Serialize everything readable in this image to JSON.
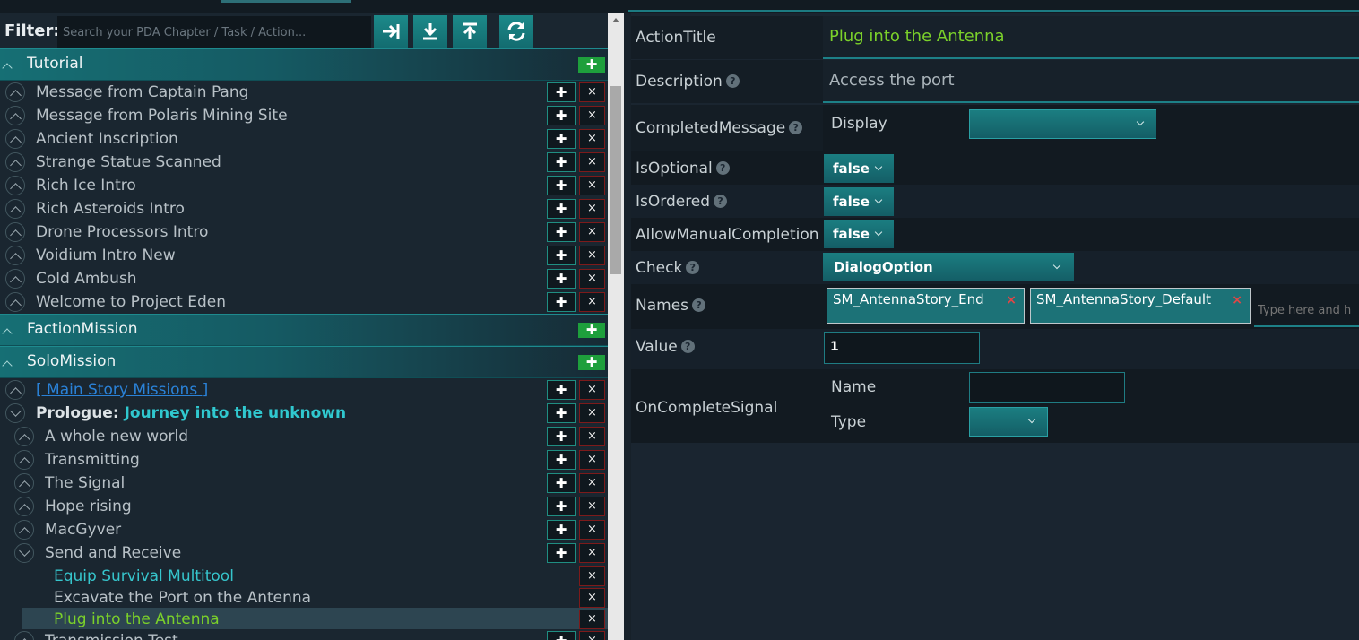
{
  "filter": {
    "label": "Filter:",
    "placeholder": "Search your PDA Chapter / Task / Action...",
    "buttons": [
      "arrow-right-bar-icon",
      "download-icon",
      "upload-icon",
      "refresh-icon"
    ]
  },
  "categories": {
    "tutorial": "Tutorial",
    "faction": "FactionMission",
    "solo": "SoloMission"
  },
  "tutorial_items": [
    "Message from Captain Pang",
    "Message from Polaris Mining Site",
    "Ancient Inscription",
    "Strange Statue Scanned",
    "Rich Ice Intro",
    "Rich Asteroids Intro",
    "Drone Processors Intro",
    "Voidium Intro New",
    "Cold Ambush",
    "Welcome to Project Eden"
  ],
  "solo_items": {
    "main_story": "[ Main Story Missions ]",
    "prologue_prefix": "Prologue:",
    "prologue_title": "Journey into the unknown",
    "tasks": [
      "A whole new world",
      "Transmitting",
      "The Signal",
      "Hope rising",
      "MacGyver",
      "Send and Receive"
    ],
    "actions": [
      "Equip Survival Multitool",
      "Excavate the Port on the Antenna",
      "Plug into the Antenna"
    ],
    "next_task": "Transmission Test"
  },
  "glyphs": {
    "plus": "✚",
    "close": "×"
  },
  "detail": {
    "action_title_label": "ActionTitle",
    "action_title_value": "Plug into the Antenna",
    "description_label": "Description",
    "description_value": "Access the port",
    "completed_message_label": "CompletedMessage",
    "display_label": "Display",
    "is_optional_label": "IsOptional",
    "is_optional_value": "false",
    "is_ordered_label": "IsOrdered",
    "is_ordered_value": "false",
    "allow_manual_label": "AllowManualCompletion",
    "allow_manual_value": "false",
    "check_label": "Check",
    "check_value": "DialogOption",
    "names_label": "Names",
    "names": [
      "SM_AntennaStory_End",
      "SM_AntennaStory_Default"
    ],
    "names_placeholder": "Type here and h",
    "value_label": "Value",
    "value_value": "1",
    "on_complete_label": "OnCompleteSignal",
    "name_label": "Name",
    "type_label": "Type",
    "help": "?"
  },
  "colors": {
    "accent": "#1b7e81",
    "selected_text": "#7bd12a",
    "title_value": "#7bd12a",
    "link": "#2a82d8",
    "highlight": "#30c8cf",
    "delete_border": "#7d1a1a",
    "add_green": "#1e9f3c"
  }
}
